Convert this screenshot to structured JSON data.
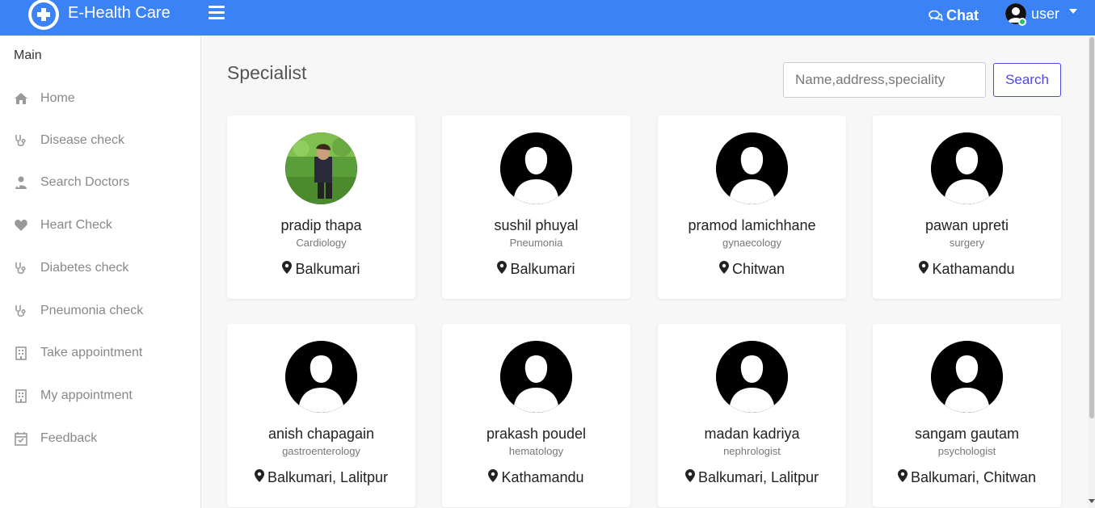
{
  "app": {
    "brand": "E-Health Care",
    "logo_icon": "medical-cross-icon",
    "accent": "#3b82f6"
  },
  "topbar": {
    "chat_label": "Chat",
    "user_label": "user"
  },
  "sidebar": {
    "title": "Main",
    "items": [
      {
        "label": "Home",
        "icon": "home-icon"
      },
      {
        "label": "Disease check",
        "icon": "stethoscope-icon"
      },
      {
        "label": "Search Doctors",
        "icon": "doctor-icon"
      },
      {
        "label": "Heart Check",
        "icon": "heart-icon"
      },
      {
        "label": "Diabetes check",
        "icon": "stethoscope-icon"
      },
      {
        "label": "Pneumonia check",
        "icon": "stethoscope-icon"
      },
      {
        "label": "Take appointment",
        "icon": "hospital-icon"
      },
      {
        "label": "My appointment",
        "icon": "hospital-icon"
      },
      {
        "label": "Feedback",
        "icon": "calendar-check-icon"
      }
    ]
  },
  "main": {
    "title": "Specialist",
    "search": {
      "placeholder": "Name,address,speciality",
      "button_label": "Search"
    },
    "doctors": [
      {
        "name": "pradip thapa",
        "speciality": "Cardiology",
        "location": "Balkumari",
        "photo": "photo"
      },
      {
        "name": "sushil phuyal",
        "speciality": "Pneumonia",
        "location": "Balkumari",
        "photo": "default-avatar"
      },
      {
        "name": "pramod lamichhane",
        "speciality": "gynaecology",
        "location": "Chitwan",
        "photo": "default-avatar"
      },
      {
        "name": "pawan upreti",
        "speciality": "surgery",
        "location": "Kathamandu",
        "photo": "default-avatar"
      },
      {
        "name": "anish chapagain",
        "speciality": "gastroenterology",
        "location": "Balkumari, Lalitpur",
        "photo": "default-avatar"
      },
      {
        "name": "prakash poudel",
        "speciality": "hematology",
        "location": "Kathamandu",
        "photo": "default-avatar"
      },
      {
        "name": "madan kadriya",
        "speciality": "nephrologist",
        "location": "Balkumari, Lalitpur",
        "photo": "default-avatar"
      },
      {
        "name": "sangam gautam",
        "speciality": "psychologist",
        "location": "Balkumari, Chitwan",
        "photo": "default-avatar"
      }
    ]
  }
}
